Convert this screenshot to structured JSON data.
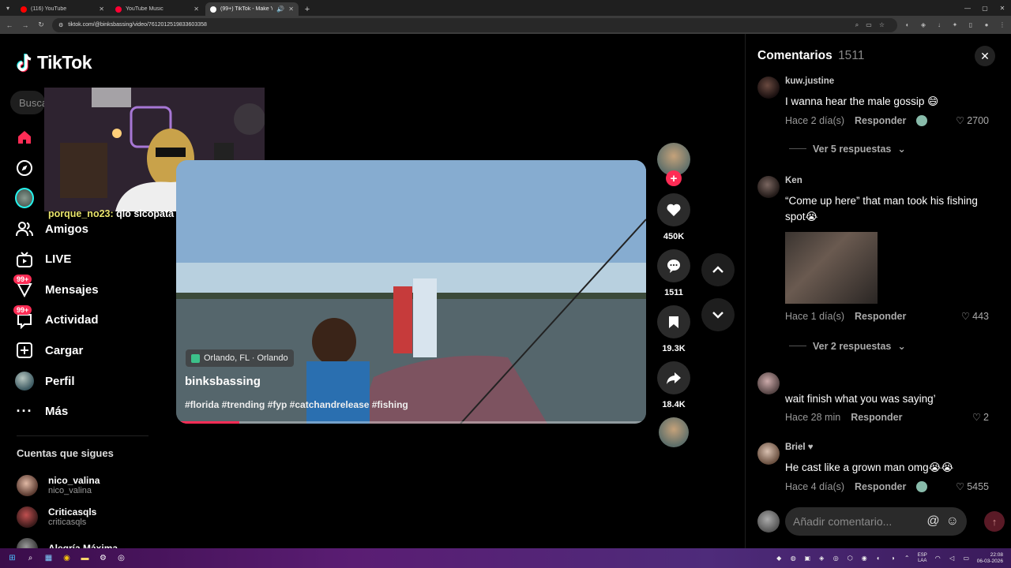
{
  "browser": {
    "tabs": [
      {
        "label": "(116) YouTube",
        "color": "#ff0000"
      },
      {
        "label": "YouTube Music",
        "color": "#ff0033"
      },
      {
        "label": "(99+) TikTok - Make Your Da...",
        "color": "#ffffff"
      }
    ],
    "url": "tiktok.com/@binksbassing/video/7612012519833603358"
  },
  "app": {
    "logo": "TikTok",
    "search_placeholder": "Buscar",
    "nav": [
      {
        "label": "",
        "icon": "home-icon"
      },
      {
        "label": "",
        "icon": "compass-icon"
      },
      {
        "label": "",
        "icon": "following-avatar-icon"
      },
      {
        "label": "Amigos",
        "icon": "friends-icon"
      },
      {
        "label": "LIVE",
        "icon": "live-icon"
      },
      {
        "label": "Mensajes",
        "icon": "messages-icon",
        "badge": "99+"
      },
      {
        "label": "Actividad",
        "icon": "activity-icon",
        "badge": "99+"
      },
      {
        "label": "Cargar",
        "icon": "upload-icon"
      },
      {
        "label": "Perfil",
        "icon": "profile-icon"
      },
      {
        "label": "Más",
        "icon": "more-icon"
      }
    ],
    "following_title": "Cuentas que sigues",
    "following": [
      {
        "name": "nico_valina",
        "handle": "nico_valina"
      },
      {
        "name": "Criticasqls",
        "handle": "criticasqls"
      },
      {
        "name": "Alegría Máxima",
        "handle": ""
      }
    ]
  },
  "stream_chat": [
    {
      "user": "porque_no23:",
      "text": "qlo sicopata"
    }
  ],
  "video": {
    "location": "Orlando, FL · Orlando",
    "username": "binksbassing",
    "tags": "#florida #trending #fyp #catchandrelease #fishing",
    "progress": 0.13,
    "likes": "450K",
    "comments": "1511",
    "saves": "19.3K",
    "shares": "18.4K"
  },
  "comments_panel": {
    "title": "Comentarios",
    "count": "1511",
    "reply_label": "Responder",
    "input_placeholder": "Añadir comentario...",
    "items": [
      {
        "user": "kuw.justine",
        "text": "I wanna hear the male gossip 😄",
        "time": "Hace 2 día(s)",
        "likes": "2700",
        "replies": "Ver 5 respuestas"
      },
      {
        "user": "Ken",
        "text": "“Come up here” that man took his fishing spot😭",
        "time": "Hace 1 día(s)",
        "likes": "443",
        "replies": "Ver 2 respuestas"
      },
      {
        "user": "",
        "text": "wait finish what you was saying’",
        "time": "Hace 28 min",
        "likes": "2",
        "replies": ""
      },
      {
        "user": "Briel",
        "text": "He cast like a grown man omg😭😭",
        "time": "Hace 4 día(s)",
        "likes": "5455",
        "replies": ""
      }
    ]
  },
  "taskbar": {
    "lang_top": "ESP",
    "lang_bottom": "LAA",
    "time": "22:08",
    "date": "06-03-2026"
  },
  "colors": {
    "accent": "#fe2c55",
    "background": "#000000"
  }
}
